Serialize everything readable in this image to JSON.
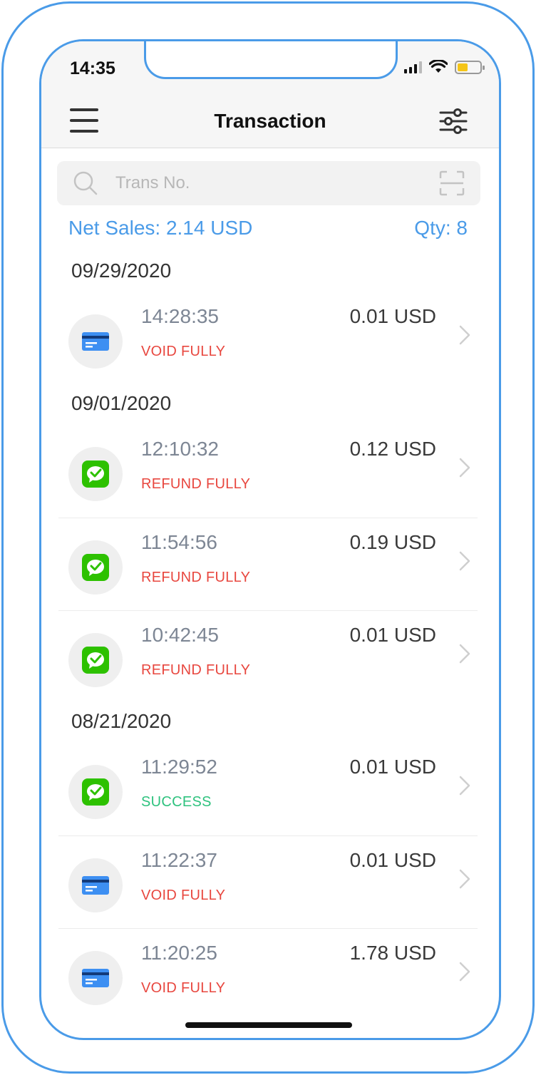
{
  "status_bar": {
    "time": "14:35"
  },
  "nav": {
    "title": "Transaction"
  },
  "search": {
    "placeholder": "Trans No."
  },
  "summary": {
    "net_sales": "Net Sales: 2.14 USD",
    "qty": "Qty: 8"
  },
  "colors": {
    "accent": "#4a9be8",
    "status_red": "#e8473f",
    "status_green": "#2ec27e",
    "wechat_green": "#2dc100",
    "card_blue": "#3d8ff2"
  },
  "groups": [
    {
      "date": "09/29/2020",
      "items": [
        {
          "icon": "card-icon",
          "time": "14:28:35",
          "amount": "0.01 USD",
          "status": "VOID FULLY",
          "status_type": "red"
        }
      ]
    },
    {
      "date": "09/01/2020",
      "items": [
        {
          "icon": "wechat-pay-icon",
          "time": "12:10:32",
          "amount": "0.12 USD",
          "status": "REFUND FULLY",
          "status_type": "red"
        },
        {
          "icon": "wechat-pay-icon",
          "time": "11:54:56",
          "amount": "0.19 USD",
          "status": "REFUND FULLY",
          "status_type": "red"
        },
        {
          "icon": "wechat-pay-icon",
          "time": "10:42:45",
          "amount": "0.01 USD",
          "status": "REFUND FULLY",
          "status_type": "red"
        }
      ]
    },
    {
      "date": "08/21/2020",
      "items": [
        {
          "icon": "wechat-pay-icon",
          "time": "11:29:52",
          "amount": "0.01 USD",
          "status": "SUCCESS",
          "status_type": "green"
        },
        {
          "icon": "card-icon",
          "time": "11:22:37",
          "amount": "0.01 USD",
          "status": "VOID FULLY",
          "status_type": "red"
        },
        {
          "icon": "card-icon",
          "time": "11:20:25",
          "amount": "1.78 USD",
          "status": "VOID FULLY",
          "status_type": "red"
        }
      ]
    }
  ]
}
